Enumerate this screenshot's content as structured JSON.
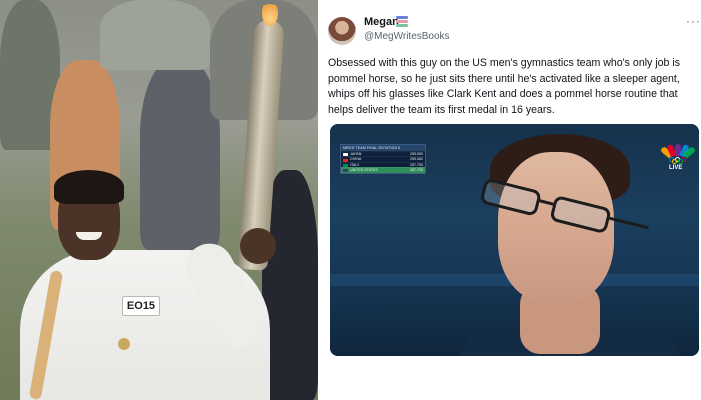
{
  "left_photo": {
    "bib_text": "EO15"
  },
  "tweet": {
    "display_name": "Megan",
    "name_emoji": "books-emoji",
    "handle": "@MegWritesBooks",
    "more_icon": "more-icon",
    "more_glyph": "···",
    "text": "Obsessed with this guy on the US men's gymnastics team who's only job is pommel horse, so he just sits there until he's activated like a sleeper agent, whips off his glasses like Clark Kent and does a pommel horse routine that helps deliver the team its first medal in 16 years.",
    "media": {
      "live_label": "LIVE",
      "scoreboard": {
        "title": "MEN'S TEAM FINAL  ROTATION 6",
        "rows": [
          {
            "country": "JAPAN",
            "score": "259.593",
            "flag": "#ffffff"
          },
          {
            "country": "CHINA",
            "score": "259.062",
            "flag": "#de2910"
          },
          {
            "country": "ITALY",
            "score": "257.793",
            "flag": "#009246"
          },
          {
            "country": "UNITED STATES",
            "score": "257.793",
            "flag": "#3c3b6e",
            "highlight": true
          }
        ]
      }
    }
  },
  "colors": {
    "text_primary": "#0f1419",
    "text_secondary": "#536471",
    "scoreboard_highlight": "#2f8f58"
  }
}
